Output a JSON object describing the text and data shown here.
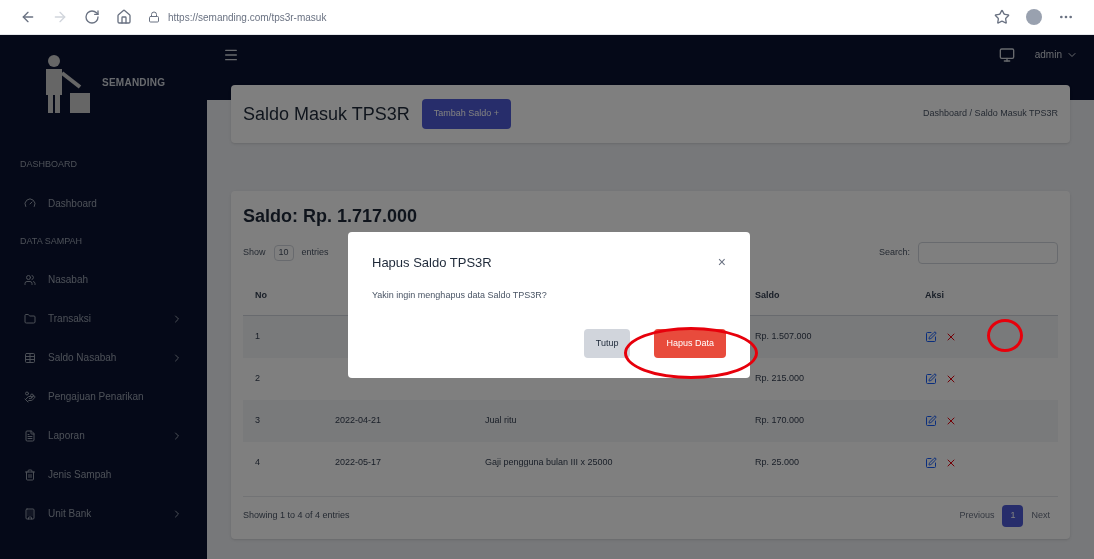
{
  "browser": {
    "url": "https://semanding.com/tps3r-masuk"
  },
  "brand": "SEMANDING",
  "user": "admin",
  "sidebar": [
    {
      "kind": "heading",
      "label": "DASHBOARD"
    },
    {
      "kind": "item",
      "label": "Dashboard",
      "expandable": false
    },
    {
      "kind": "heading",
      "label": "DATA SAMPAH"
    },
    {
      "kind": "item",
      "label": "Nasabah",
      "expandable": false
    },
    {
      "kind": "item",
      "label": "Transaksi",
      "expandable": true
    },
    {
      "kind": "item",
      "label": "Saldo Nasabah",
      "expandable": true
    },
    {
      "kind": "item",
      "label": "Pengajuan Penarikan",
      "expandable": false
    },
    {
      "kind": "item",
      "label": "Laporan",
      "expandable": true
    },
    {
      "kind": "item",
      "label": "Jenis Sampah",
      "expandable": false
    },
    {
      "kind": "item",
      "label": "Unit Bank",
      "expandable": true
    }
  ],
  "page": {
    "title": "Saldo Masuk TPS3R",
    "add_button": "Tambah Saldo +",
    "breadcrumb": "Dashboard / Saldo Masuk TPS3R"
  },
  "balance": "Saldo: Rp. 1.717.000",
  "table": {
    "show_label": "Show",
    "page_size": "10",
    "entries_label": "entries",
    "search_label": "Search:",
    "columns": [
      {
        "kind": "no",
        "label": "No"
      },
      {
        "kind": "amount",
        "label": "Saldo"
      },
      {
        "kind": "action",
        "label": "Aksi"
      }
    ],
    "rows": [
      {
        "no": "1",
        "amount": "Rp. 1.507.000"
      },
      {
        "no": "2",
        "amount": "Rp. 215.000"
      },
      {
        "no": "3",
        "date": "2022-04-21",
        "note": "Jual ritu",
        "amount": "Rp. 170.000"
      },
      {
        "no": "4",
        "date": "2022-05-17",
        "note": "Gaji pengguna bulan III x 25000",
        "amount": "Rp. 25.000"
      }
    ],
    "info": "Showing 1 to 4 of 4 entries",
    "pagination": [
      {
        "label": "Previous",
        "selected": false
      },
      {
        "label": "1",
        "selected": true
      },
      {
        "label": "Next",
        "selected": false
      }
    ]
  },
  "modal": {
    "title": "Hapus Saldo TPS3R",
    "close": "×",
    "message": "Yakin ingin menghapus data Saldo TPS3R?",
    "cancel": "Tutup",
    "confirm": "Hapus Data"
  }
}
